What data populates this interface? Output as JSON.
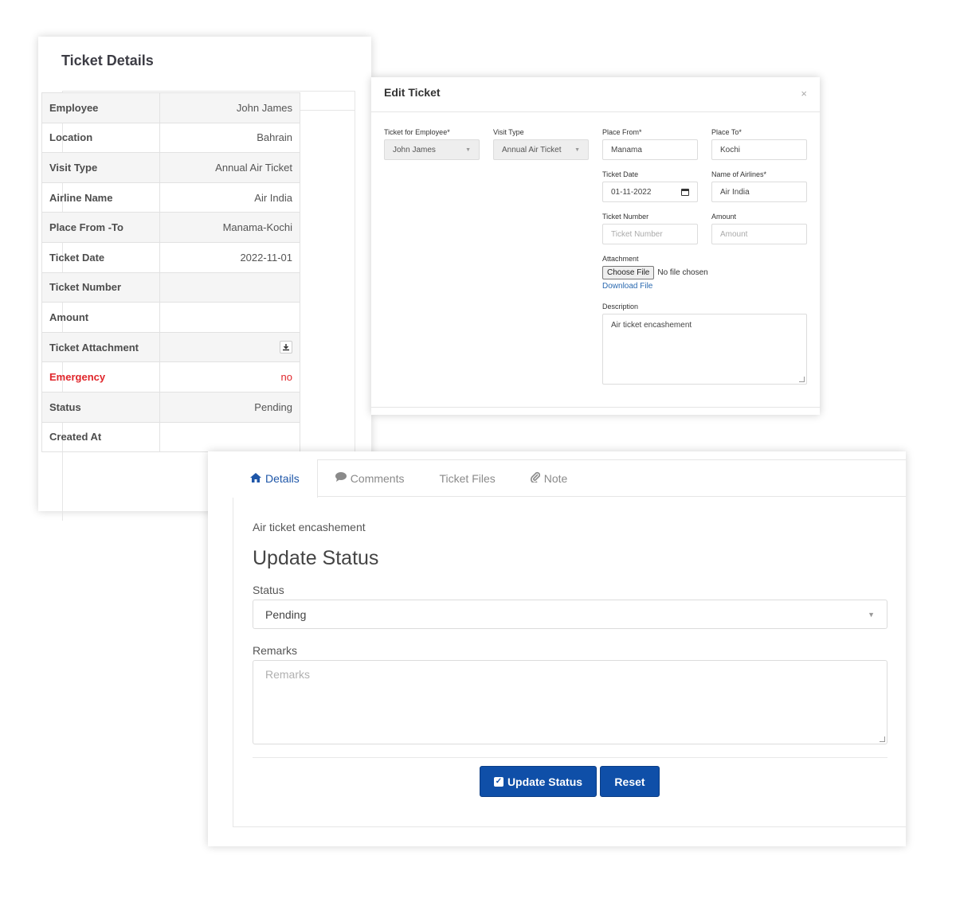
{
  "ticket_details": {
    "title": "Ticket Details",
    "rows": [
      {
        "label": "Employee",
        "value": "John James"
      },
      {
        "label": "Location",
        "value": "Bahrain"
      },
      {
        "label": "Visit Type",
        "value": "Annual Air Ticket"
      },
      {
        "label": "Airline Name",
        "value": "Air India"
      },
      {
        "label": "Place From -To",
        "value": "Manama-Kochi"
      },
      {
        "label": "Ticket Date",
        "value": "2022-11-01"
      },
      {
        "label": "Ticket Number",
        "value": ""
      },
      {
        "label": "Amount",
        "value": ""
      },
      {
        "label": "Ticket Attachment",
        "value": "",
        "icon": "download-icon"
      },
      {
        "label": "Emergency",
        "value": "no",
        "color": "#e0262b"
      },
      {
        "label": "Status",
        "value": "Pending"
      },
      {
        "label": "Created At",
        "value": ""
      }
    ]
  },
  "edit_ticket": {
    "title": "Edit Ticket",
    "close": "×",
    "employee_label": "Ticket for Employee*",
    "employee_value": "John James",
    "visit_type_label": "Visit Type",
    "visit_type_value": "Annual Air Ticket",
    "place_from_label": "Place From*",
    "place_from_value": "Manama",
    "place_to_label": "Place To*",
    "place_to_value": "Kochi",
    "ticket_date_label": "Ticket Date",
    "ticket_date_value": "01-11-2022",
    "airline_label": "Name of Airlines*",
    "airline_value": "Air India",
    "ticket_number_label": "Ticket Number",
    "ticket_number_placeholder": "Ticket Number",
    "amount_label": "Amount",
    "amount_placeholder": "Amount",
    "attachment_label": "Attachment",
    "choose_file": "Choose File",
    "no_file": "No file chosen",
    "download_file": "Download File",
    "description_label": "Description",
    "description_value": "Air ticket encashement"
  },
  "update_status": {
    "tabs": [
      {
        "label": "Details",
        "icon": "home-icon",
        "active": true
      },
      {
        "label": "Comments",
        "icon": "comment-icon",
        "active": false
      },
      {
        "label": "Ticket Files",
        "icon": "",
        "active": false
      },
      {
        "label": "Note",
        "icon": "paperclip-icon",
        "active": false
      }
    ],
    "description": "Air ticket encashement",
    "heading": "Update Status",
    "status_label": "Status",
    "status_value": "Pending",
    "remarks_label": "Remarks",
    "remarks_placeholder": "Remarks",
    "update_button": "Update Status",
    "reset_button": "Reset"
  },
  "colors": {
    "primary": "#0f4fa8",
    "danger": "#e0262b",
    "link": "#2a69b0"
  }
}
